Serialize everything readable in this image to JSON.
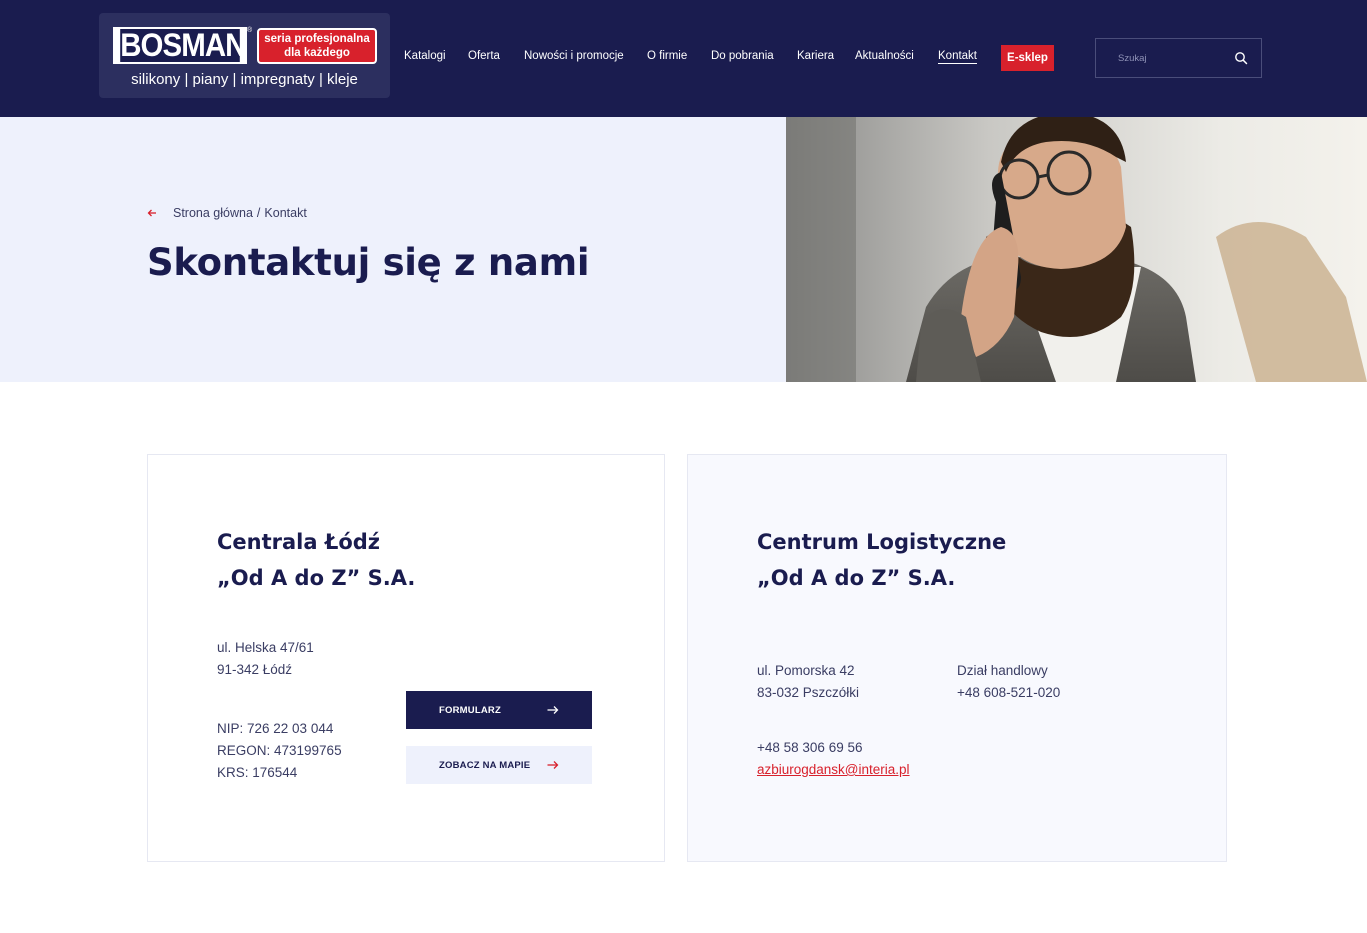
{
  "header": {
    "logo": {
      "word": "BOSMAN",
      "reg": "®",
      "badge_line1": "seria profesjonalna",
      "badge_line2": "dla każdego",
      "subtitle": "silikony | piany | impregnaty | kleje"
    },
    "nav": [
      {
        "label": "Katalogi"
      },
      {
        "label": "Oferta"
      },
      {
        "label": "Nowości i promocje"
      },
      {
        "label": "O firmie"
      },
      {
        "label": "Do pobrania"
      },
      {
        "label": "Kariera"
      },
      {
        "label": "Aktualności"
      },
      {
        "label": "Kontakt",
        "active": true
      }
    ],
    "eshop_label": "E-sklep",
    "search": {
      "placeholder": "Szukaj",
      "value": ""
    }
  },
  "hero": {
    "breadcrumb": {
      "home": "Strona główna",
      "separator": "/",
      "current": "Kontakt"
    },
    "title": "Skontaktuj się z nami"
  },
  "card_left": {
    "title_line1": "Centrala Łódź",
    "title_line2": "„Od A do Z” S.A.",
    "address": [
      "ul. Helska 47/61",
      "91-342 Łódź"
    ],
    "company_ids": [
      "NIP: 726 22 03 044",
      "REGON: 473199765",
      "KRS: 176544"
    ],
    "btn_form": "FORMULARZ",
    "btn_map": "ZOBACZ NA MAPIE"
  },
  "card_right": {
    "title_line1": "Centrum Logistyczne",
    "title_line2": "„Od A do Z” S.A.",
    "address": [
      "ul. Pomorska 42",
      "83-032 Pszczółki"
    ],
    "sales": [
      "Dział handlowy",
      "+48 608-521-020"
    ],
    "phone": "+48 58 306 69 56",
    "email": "azbiurogdansk@interia.pl"
  },
  "colors": {
    "navy": "#1a1c4f",
    "accent_red": "#d8212c",
    "hero_bg": "#eef1fc"
  }
}
